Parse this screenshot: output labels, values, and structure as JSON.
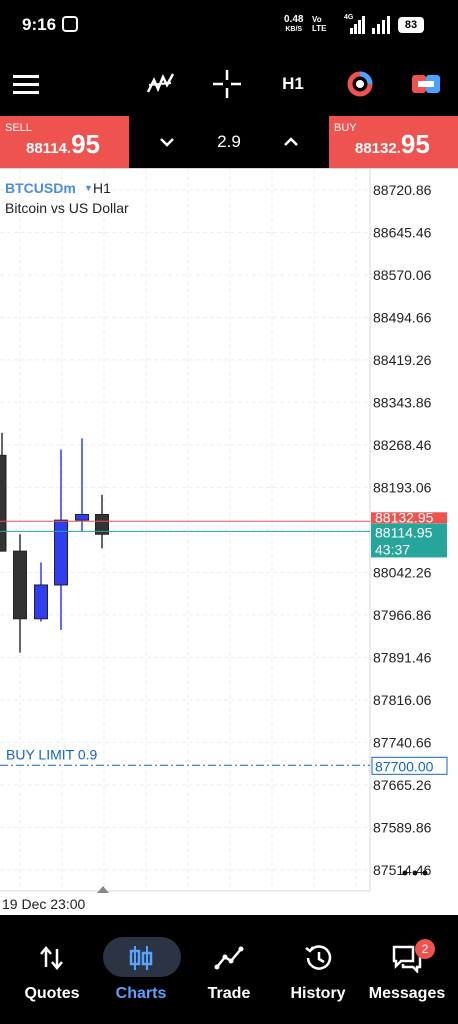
{
  "status_bar": {
    "time": "9:16",
    "net_speed": "0.48",
    "net_unit": "KB/S",
    "volte": "Vo LTE",
    "network_gen": "4G",
    "battery": "83"
  },
  "toolbar": {
    "timeframe": "H1"
  },
  "trade": {
    "sell_label": "SELL",
    "sell_prefix": "88114.",
    "sell_big": "95",
    "spread": "2.9",
    "buy_label": "BUY",
    "buy_prefix": "88132.",
    "buy_big": "95"
  },
  "chart": {
    "symbol": "BTCUSDm",
    "timeframe": "H1",
    "description": "Bitcoin vs US Dollar",
    "price_ticks": [
      "88720.86",
      "88645.46",
      "88570.06",
      "88494.66",
      "88419.26",
      "88343.86",
      "88268.46",
      "88193.06",
      "88117.66",
      "88042.26",
      "87966.86",
      "87891.46",
      "87816.06",
      "87740.66",
      "87665.26",
      "87589.86",
      "87514.46"
    ],
    "ask_price": "88132.95",
    "bid_price": "88114.95",
    "bar_timer": "43:37",
    "order_label": "BUY LIMIT 0.9",
    "order_price": "87700.00",
    "date_label": "19 Dec 23:00",
    "colors": {
      "bull": "#2f3ff0",
      "bear": "#333333",
      "ask_line": "#ef5350",
      "bid_line": "#26a69a",
      "order_line": "#1565c0"
    }
  },
  "chart_data": {
    "type": "candlestick",
    "ylim": [
      87477,
      88758
    ],
    "candles": [
      {
        "open": 88250,
        "high": 88290,
        "low": 88080,
        "close": 88080,
        "direction": "bear"
      },
      {
        "open": 88080,
        "high": 88110,
        "low": 87900,
        "close": 87960,
        "direction": "bear"
      },
      {
        "open": 87960,
        "high": 88060,
        "low": 87955,
        "close": 88020,
        "direction": "bull"
      },
      {
        "open": 88020,
        "high": 88260,
        "low": 87940,
        "close": 88135,
        "direction": "bull"
      },
      {
        "open": 88135,
        "high": 88280,
        "low": 88115,
        "close": 88145,
        "direction": "bull"
      },
      {
        "open": 88145,
        "high": 88180,
        "low": 88085,
        "close": 88110,
        "direction": "bear"
      }
    ]
  },
  "nav": {
    "items": [
      {
        "label": "Quotes"
      },
      {
        "label": "Charts"
      },
      {
        "label": "Trade"
      },
      {
        "label": "History"
      },
      {
        "label": "Messages",
        "badge": "2"
      }
    ]
  }
}
